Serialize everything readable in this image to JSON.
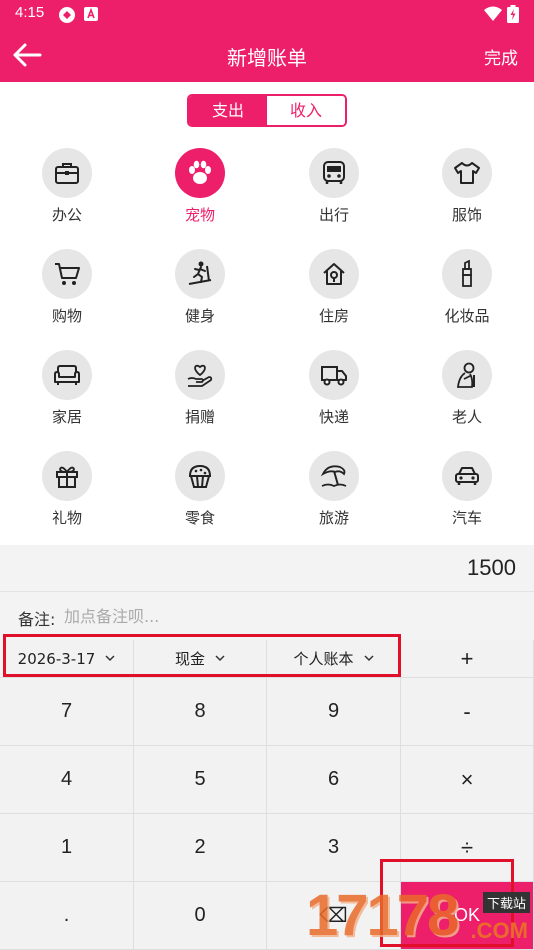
{
  "status_bar": {
    "time": "4:15"
  },
  "app_bar": {
    "title": "新增账单",
    "done_label": "完成"
  },
  "segment": {
    "expense_label": "支出",
    "income_label": "收入",
    "selected": "支出"
  },
  "categories": [
    {
      "label": "办公",
      "icon": "briefcase-icon"
    },
    {
      "label": "宠物",
      "icon": "paw-icon",
      "selected": true
    },
    {
      "label": "出行",
      "icon": "bus-icon"
    },
    {
      "label": "服饰",
      "icon": "tshirt-icon"
    },
    {
      "label": "购物",
      "icon": "shopping-cart-icon"
    },
    {
      "label": "健身",
      "icon": "treadmill-icon"
    },
    {
      "label": "住房",
      "icon": "house-icon"
    },
    {
      "label": "化妆品",
      "icon": "lipstick-icon"
    },
    {
      "label": "家居",
      "icon": "sofa-icon"
    },
    {
      "label": "捐赠",
      "icon": "heart-hand-icon"
    },
    {
      "label": "快递",
      "icon": "delivery-truck-icon"
    },
    {
      "label": "老人",
      "icon": "elderly-icon"
    },
    {
      "label": "礼物",
      "icon": "gift-icon"
    },
    {
      "label": "零食",
      "icon": "cupcake-icon"
    },
    {
      "label": "旅游",
      "icon": "beach-umbrella-icon"
    },
    {
      "label": "汽车",
      "icon": "car-icon"
    }
  ],
  "amount": "1500",
  "note": {
    "label": "备注:",
    "placeholder": "加点备注呗..."
  },
  "selectors": {
    "date": "2026-3-17",
    "account_type": "现金",
    "book": "个人账本"
  },
  "keypad": {
    "plus": "+",
    "minus": "-",
    "multiply": "×",
    "divide": "÷",
    "digits": [
      "7",
      "8",
      "9",
      "4",
      "5",
      "6",
      "1",
      "2",
      "3"
    ],
    "dot": ".",
    "zero": "0",
    "backspace": "⌫",
    "ok": "OK"
  },
  "watermark": {
    "number": "17178",
    "tag": "下载站",
    "domain": ".COM"
  },
  "colors": {
    "primary": "#ee1f6a",
    "highlight_box": "#e0102a",
    "icon_bg": "#e6e6e6"
  }
}
